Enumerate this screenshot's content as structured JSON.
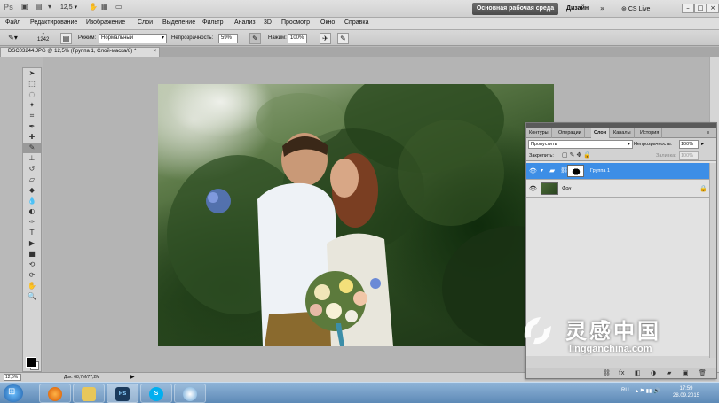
{
  "app": {
    "zoom_display": "12,5",
    "workspace_button": "Основная рабочая среда",
    "workspace_alt": "Дизайн",
    "cslive": "CS Live",
    "overflow": "»"
  },
  "menu": [
    "Файл",
    "Редактирование",
    "Изображение",
    "Слои",
    "Выделение",
    "Фильтр",
    "Анализ",
    "3D",
    "Просмотр",
    "Окно",
    "Справка"
  ],
  "options": {
    "brush_size": "1242",
    "mode_label": "Режим:",
    "mode_value": "Нормальный",
    "opacity_label": "Непрозрачность:",
    "opacity_value": "59%",
    "flow_label": "Нажим:",
    "flow_value": "100%"
  },
  "document": {
    "tab_title": "DSC03244.JPG @ 12,5% (Группа 1, Слой-маска/8) *",
    "close": "×"
  },
  "statusbar": {
    "zoom": "12,5%",
    "doc_info": "Док: 68,7M/77,2M"
  },
  "layers_panel": {
    "tabs": [
      "Контуры",
      "Операции",
      "Слои",
      "Каналы",
      "История"
    ],
    "active_tab": "Слои",
    "blend_mode": "Пропустить",
    "opacity_label": "Непрозрачность:",
    "opacity_value": "100%",
    "lock_label": "Закрепить:",
    "fill_label": "Заливка:",
    "fill_value": "100%",
    "layers": [
      {
        "name": "Группа 1",
        "selected": true
      },
      {
        "name": "Фон",
        "selected": false
      }
    ]
  },
  "taskbar": {
    "apps": [
      "windows-start",
      "firefox",
      "explorer",
      "photoshop",
      "skype",
      "corel"
    ],
    "language": "RU",
    "time": "17:59",
    "date": "28.09.2015"
  },
  "watermark": {
    "chinese": "灵感中国",
    "url": "lingganchina.com"
  },
  "colors": {
    "selected_layer": "#3d8ee6",
    "foreground": "#000000",
    "background": "#ffffff"
  }
}
